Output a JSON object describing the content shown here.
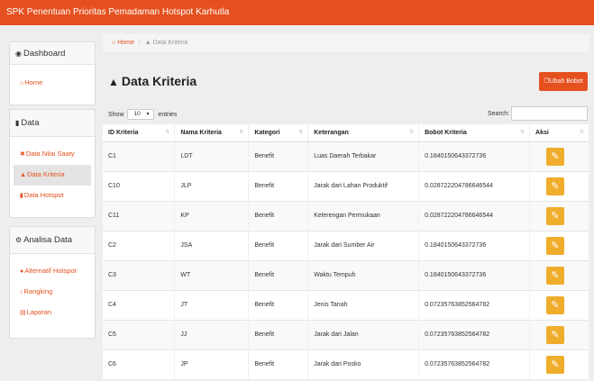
{
  "app": {
    "title": "SPK Penentuan Prioritas Pemadaman Hotspot Karhutla"
  },
  "sidebar": {
    "panels": [
      {
        "heading": "Dashboard",
        "icon": "dashboard-icon",
        "items": [
          {
            "label": "Home",
            "icon": "home-icon",
            "active": false
          }
        ]
      },
      {
        "heading": "Data",
        "icon": "file-icon",
        "items": [
          {
            "label": "Data Nilai Saaty",
            "icon": "table-icon",
            "active": false
          },
          {
            "label": "Data Kriteria",
            "icon": "institution-icon",
            "active": true
          },
          {
            "label": "Data Hotspot",
            "icon": "book-icon",
            "active": false
          }
        ]
      },
      {
        "heading": "Analisa Data",
        "icon": "cogs-icon",
        "items": [
          {
            "label": "Alternatif Hotspot",
            "icon": "fire-icon",
            "active": false
          },
          {
            "label": "Rangking",
            "icon": "sort-icon",
            "active": false
          },
          {
            "label": "Laporan",
            "icon": "report-icon",
            "active": false
          }
        ]
      }
    ]
  },
  "breadcrumb": {
    "home": "Home",
    "sep": "/",
    "current": "Data Kriteria"
  },
  "page": {
    "title": "Data Kriteria",
    "ubah_bobot": "Ubah Bobot"
  },
  "table_controls": {
    "show": "Show",
    "entries_value": "10",
    "entries": "entries",
    "search": "Search:"
  },
  "table": {
    "columns": [
      "ID Kriteria",
      "Nama Kriteria",
      "Kategori",
      "Keterangan",
      "Bobot Kriteria",
      "Aksi"
    ],
    "rows": [
      [
        "C1",
        "LDT",
        "Benefit",
        "Luas Daerah Terbakar",
        "0.1840150643372736"
      ],
      [
        "C10",
        "JLP",
        "Benefit",
        "Jarak dari Lahan Produktif",
        "0.028722204786646544"
      ],
      [
        "C11",
        "KP",
        "Benefit",
        "Kelerengan Permukaan",
        "0.028722204786646544"
      ],
      [
        "C2",
        "JSA",
        "Benefit",
        "Jarak dari Sumber Air",
        "0.1840150643372736"
      ],
      [
        "C3",
        "WT",
        "Benefit",
        "Waktu Tempuh",
        "0.1840150643372736"
      ],
      [
        "C4",
        "JT",
        "Benefit",
        "Jenis Tanah",
        "0.07235763852564782"
      ],
      [
        "C5",
        "JJ",
        "Benefit",
        "Jarak dari Jalan",
        "0.07235763852564782"
      ],
      [
        "C6",
        "JP",
        "Benefit",
        "Jarak dari Posko",
        "0.07235763852564782"
      ]
    ]
  },
  "colors": {
    "accent": "#e5501f",
    "edit": "#f0ad2c"
  }
}
